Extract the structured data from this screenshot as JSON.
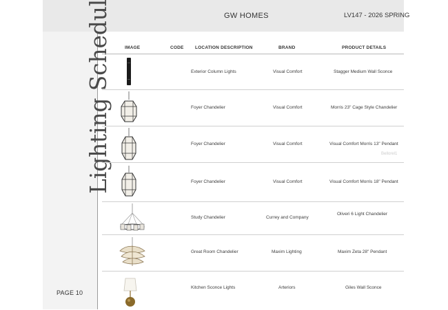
{
  "header": {
    "brand": "GW HOMES",
    "project": "LV147 - 2026 SPRING"
  },
  "sidebar": {
    "title": "Lighting Schedule",
    "page": "PAGE 10"
  },
  "table": {
    "columns": [
      "IMAGE",
      "CODE",
      "LOCATION DESCRIPTION",
      "BRAND",
      "PRODUCT DETAILS"
    ],
    "rows": [
      {
        "icon": "column-sconce-icon",
        "code": "",
        "location": "Exterior Column Lights",
        "brand": "Visual Comfort",
        "product": "Stagger Medium Wall Sconce"
      },
      {
        "icon": "cage-chandelier-icon",
        "code": "",
        "location": "Foyer Chandelier",
        "brand": "Visual Comfort",
        "product": "Morris 23\" Cage Style Chandelier"
      },
      {
        "icon": "lantern-pendant-icon",
        "code": "",
        "location": "Foyer Chandelier",
        "brand": "Visual Comfort",
        "product": "Visual Comfort Morris 13\" Pendant"
      },
      {
        "icon": "lantern-pendant-icon",
        "code": "",
        "location": "Foyer Chandelier",
        "brand": "Visual Comfort",
        "product": "Visual Comfort Morris 18\" Pendant"
      },
      {
        "icon": "ring-chandelier-icon",
        "code": "",
        "location": "Study Chandelier",
        "brand": "Currey and Company",
        "product": "Oliveri 6 Light Chandelier"
      },
      {
        "icon": "zeta-pendant-icon",
        "code": "",
        "location": "Great Room Chandelier",
        "brand": "Maxim Lighting",
        "product": "Maxim Zeta 28\" Pendant"
      },
      {
        "icon": "wall-sconce-icon",
        "code": "",
        "location": "Kitchen Sconce Lights",
        "brand": "Arteriors",
        "product": "Giles Wall Sconce"
      }
    ]
  },
  "watermark": "Bellorel1"
}
